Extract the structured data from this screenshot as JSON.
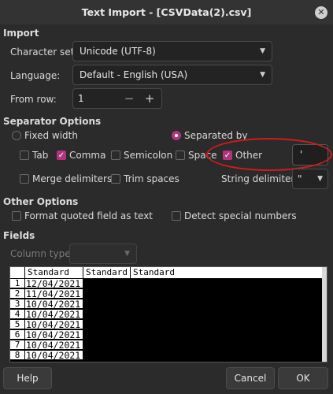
{
  "window": {
    "title": "Text Import - [CSVData(2).csv]"
  },
  "import": {
    "section_label": "Import",
    "charset_label": "Character set:",
    "charset_value": "Unicode (UTF-8)",
    "language_label": "Language:",
    "language_value": "Default - English (USA)",
    "fromrow_label": "From row:",
    "fromrow_value": "1",
    "minus": "−",
    "plus": "+"
  },
  "separator": {
    "section_label": "Separator Options",
    "fixed_width": "Fixed width",
    "separated_by": "Separated by",
    "tab": "Tab",
    "comma": "Comma",
    "semicolon": "Semicolon",
    "space": "Space",
    "other": "Other",
    "other_value": "'",
    "merge": "Merge delimiters",
    "trim": "Trim spaces",
    "string_delim_label": "String delimiter:",
    "string_delim_value": "\""
  },
  "other_options": {
    "section_label": "Other Options",
    "quoted": "Format quoted field as text",
    "special": "Detect special numbers"
  },
  "fields": {
    "section_label": "Fields",
    "column_type_label": "Column type:",
    "headers": [
      "Standard",
      "Standard",
      "Standard"
    ],
    "row_numbers": [
      "1",
      "2",
      "3",
      "4",
      "5",
      "6",
      "7",
      "8"
    ],
    "rows": [
      "12/04/2021",
      "11/04/2021",
      "10/04/2021",
      "10/04/2021",
      "10/04/2021",
      "10/04/2021",
      "10/04/2021",
      "10/04/2021"
    ]
  },
  "buttons": {
    "help": "Help",
    "cancel": "Cancel",
    "ok": "OK"
  }
}
